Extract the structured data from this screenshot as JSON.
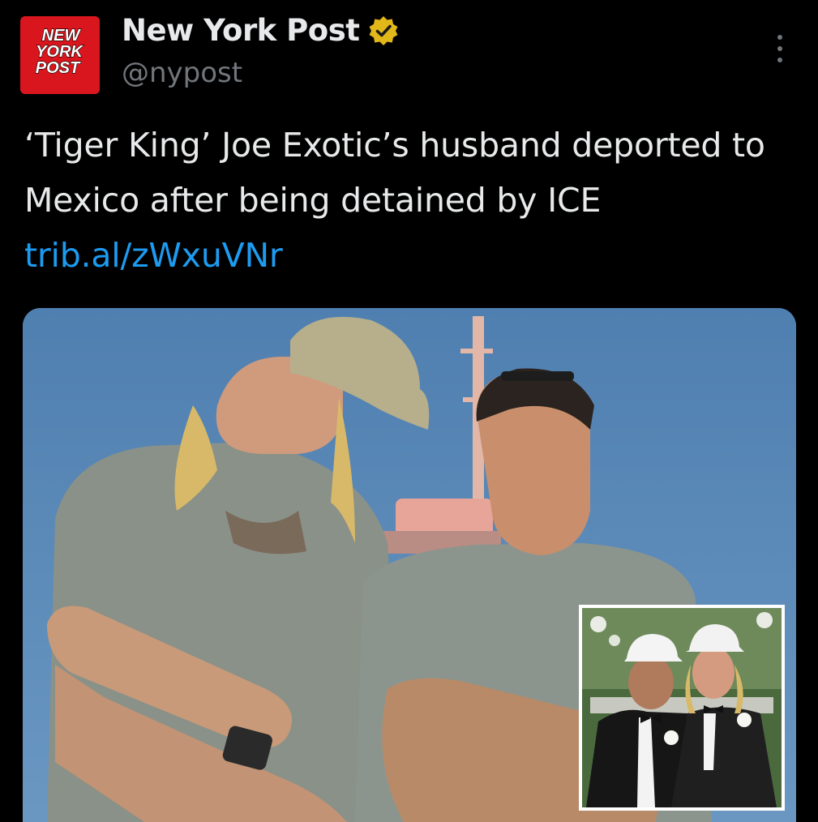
{
  "author": {
    "avatar_lines": [
      "NEW",
      "YORK",
      "POST"
    ],
    "display_name": "New York Post",
    "handle": "@nypost",
    "verified_icon": "gold-verified-badge-icon",
    "more_icon": "more-options-icon"
  },
  "tweet": {
    "text": "‘Tiger King’ Joe Exotic’s husband deported to Mexico after being detained by ICE",
    "link": "trib.al/zWxuVNr"
  },
  "colors": {
    "background": "#000000",
    "text": "#e7e9ea",
    "muted": "#71767b",
    "link": "#1d9bf0",
    "brand_red": "#d9161d",
    "verified_gold": "#e2b719"
  }
}
